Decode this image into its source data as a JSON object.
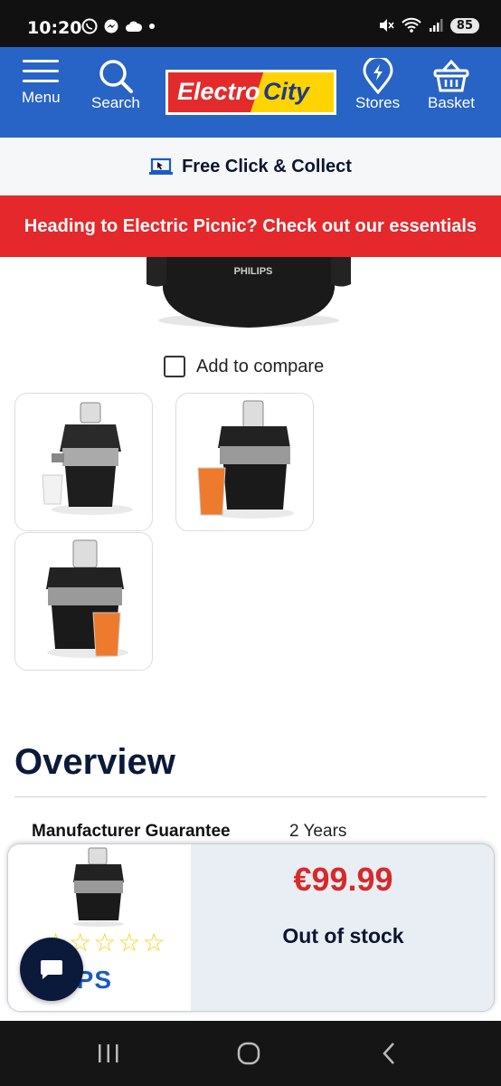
{
  "status_bar": {
    "time": "10:20",
    "battery": "85",
    "icons": [
      "whatsapp-icon",
      "messenger-icon",
      "cloud-icon",
      "dot-icon",
      "mute-icon",
      "wifi-icon",
      "signal-icon",
      "battery-icon"
    ]
  },
  "header": {
    "menu_label": "Menu",
    "search_label": "Search",
    "logo_part1": "Electro",
    "logo_part2": "City",
    "stores_label": "Stores",
    "basket_label": "Basket",
    "background": "#2863c6"
  },
  "collect_bar": {
    "text": "Free Click & Collect"
  },
  "promo_bar": {
    "text": "Heading to Electric Picnic? Check out our essentials",
    "background": "#e4282b"
  },
  "product": {
    "image_brand_text": "PHILIPS",
    "compare_label": "Add to compare",
    "thumbnails": [
      "juicer-side-view",
      "juicer-with-orange-juice",
      "juicer-front-with-juice"
    ]
  },
  "overview": {
    "title": "Overview",
    "specs": [
      {
        "label": "Manufacturer Guarantee",
        "value": "2 Years"
      }
    ]
  },
  "sticky_bar": {
    "price": "€99.99",
    "stock": "Out of stock",
    "rating_stars": 5,
    "brand_text": "ILIPS",
    "price_color": "#d62a2a"
  },
  "nav": {
    "recent_icon": "recent-apps-icon",
    "home_icon": "home-icon",
    "back_icon": "back-icon"
  }
}
